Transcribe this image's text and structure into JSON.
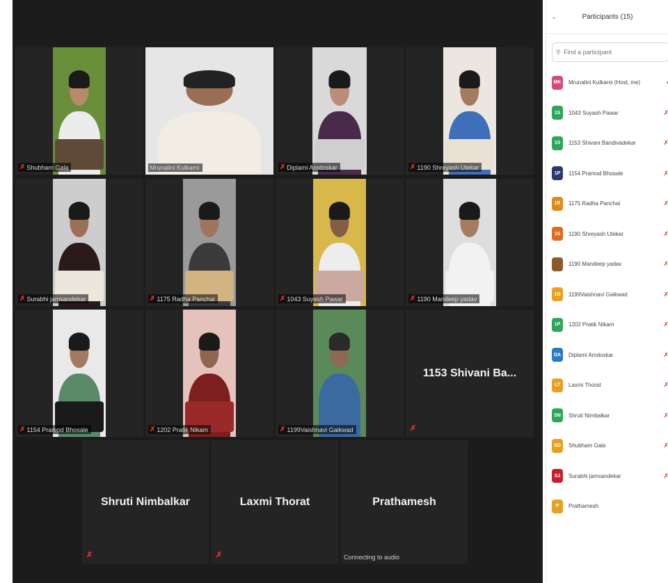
{
  "colors": {
    "accent": "#c8e04a",
    "muted_red": "#e0312f"
  },
  "gallery": {
    "tiles": [
      {
        "name": "Shubham Gala",
        "muted": true,
        "video": true,
        "bg": "#6a8f3a",
        "skin": "#b88a6a",
        "shirt": "#ececec",
        "hair": "#1a1a1a",
        "book": "#5e4a36"
      },
      {
        "name": "Mrunalini Kulkarni",
        "muted": false,
        "video": true,
        "active": true,
        "bg": "#e6e6e6",
        "skin": "#9a6e55",
        "shirt": "#f1ece4",
        "hair": "#222222"
      },
      {
        "name": "Diplami Amdoskar",
        "muted": true,
        "video": true,
        "bg": "#d9d9d9",
        "skin": "#b98d78",
        "shirt": "#4a2a4a",
        "hair": "#1a1a1a",
        "book": "#cfcfcf"
      },
      {
        "name": "1190 Shreyash Utekar",
        "muted": true,
        "video": true,
        "bg": "#ece6e0",
        "skin": "#a47a60",
        "shirt": "#3f6fb8",
        "hair": "#1a1a1a",
        "book": "#e9e1d3"
      },
      {
        "name": "Surabhi jamsandekar",
        "muted": true,
        "video": true,
        "bg": "#cdcdcd",
        "skin": "#9c7058",
        "shirt": "#2a1a1a",
        "hair": "#1a1a1a",
        "book": "#ece7dd"
      },
      {
        "name": "1175 Radha Panchal",
        "muted": true,
        "video": true,
        "bg": "#9a9a9a",
        "skin": "#9f7561",
        "shirt": "#3a3a3a",
        "hair": "#1a1a1a",
        "book": "#d2b482"
      },
      {
        "name": "1043 Suyash Pawar",
        "muted": true,
        "video": true,
        "bg": "#d8b84a",
        "skin": "#835d45",
        "shirt": "#ededed",
        "hair": "#1a1a1a",
        "book": "#c9a9a0"
      },
      {
        "name": "1190 Mandeep yadav",
        "muted": true,
        "video": true,
        "bg": "#dedede",
        "skin": "#a77b60",
        "shirt": "#f2f2f2",
        "hair": "#1a1a1a",
        "book": "#f2f2f2"
      },
      {
        "name": "1154 Pramod Bhosale",
        "muted": true,
        "video": true,
        "bg": "#e9e9e9",
        "skin": "#a37a5f",
        "shirt": "#5a8a6a",
        "hair": "#1a1a1a",
        "book": "#1a1a1a"
      },
      {
        "name": "1202 Pratik Nikam",
        "muted": true,
        "video": true,
        "bg": "#e5c2bb",
        "skin": "#8e6650",
        "shirt": "#7e1e1e",
        "hair": "#1a1a1a",
        "book": "#9a2a2a"
      },
      {
        "name": "1199Vaishnavi Gaikwad",
        "muted": true,
        "video": true,
        "bg": "#5a8a5a",
        "skin": "#8c6a55",
        "shirt": "#3a6aa0",
        "hair": "#2a2a2a"
      },
      {
        "name": "1153 Shivani Ba...",
        "muted": true,
        "video": false
      },
      {
        "name": "Shruti Nimbalkar",
        "muted": true,
        "video": false
      },
      {
        "name": "Laxmi Thorat",
        "muted": true,
        "video": false
      },
      {
        "name": "Prathamesh",
        "muted": false,
        "video": false,
        "status": "Connecting to audio"
      }
    ]
  },
  "panel": {
    "title": "Participants (15)",
    "search_placeholder": "Find a participant",
    "participants": [
      {
        "initials": "MK",
        "name": "Mrunalini Kulkarni (Host, me)",
        "color": "#d64a7a",
        "status": "host"
      },
      {
        "initials": "1S",
        "name": "1043 Suyash Pawar",
        "color": "#2ea55a",
        "status": "muted"
      },
      {
        "initials": "1S",
        "name": "1153 Shivani Bandivadekar",
        "color": "#2ea55a",
        "status": "muted"
      },
      {
        "initials": "1P",
        "name": "1154 Pramod Bhosale",
        "color": "#2b3a6e",
        "status": "muted"
      },
      {
        "initials": "1R",
        "name": "1175 Radha Panchal",
        "color": "#e08a1e",
        "status": "muted"
      },
      {
        "initials": "1S",
        "name": "1190 Shreyash Utekar",
        "color": "#e06a1e",
        "status": "muted"
      },
      {
        "initials": "",
        "name": "1190 Mandeep yadav",
        "color": "#8a5a2a",
        "status": "muted"
      },
      {
        "initials": "1G",
        "name": "1199Vaishnavi Gaikwad",
        "color": "#e8a020",
        "status": "muted"
      },
      {
        "initials": "1P",
        "name": "1202 Pratik Nikam",
        "color": "#2ea55a",
        "status": "muted"
      },
      {
        "initials": "DA",
        "name": "Diplami Amdoskar",
        "color": "#2a7ac8",
        "status": "muted"
      },
      {
        "initials": "LT",
        "name": "Laxmi Thorat",
        "color": "#e8a020",
        "status": "muted"
      },
      {
        "initials": "SN",
        "name": "Shruti Nimbalkar",
        "color": "#2ea55a",
        "status": "muted"
      },
      {
        "initials": "SG",
        "name": "Shubham Gala",
        "color": "#e8a020",
        "status": "muted"
      },
      {
        "initials": "SJ",
        "name": "Surabhi jamsandekar",
        "color": "#c8202a",
        "status": "muted"
      },
      {
        "initials": "P",
        "name": "Prathamesh",
        "color": "#e8a020",
        "status": "none"
      }
    ]
  }
}
